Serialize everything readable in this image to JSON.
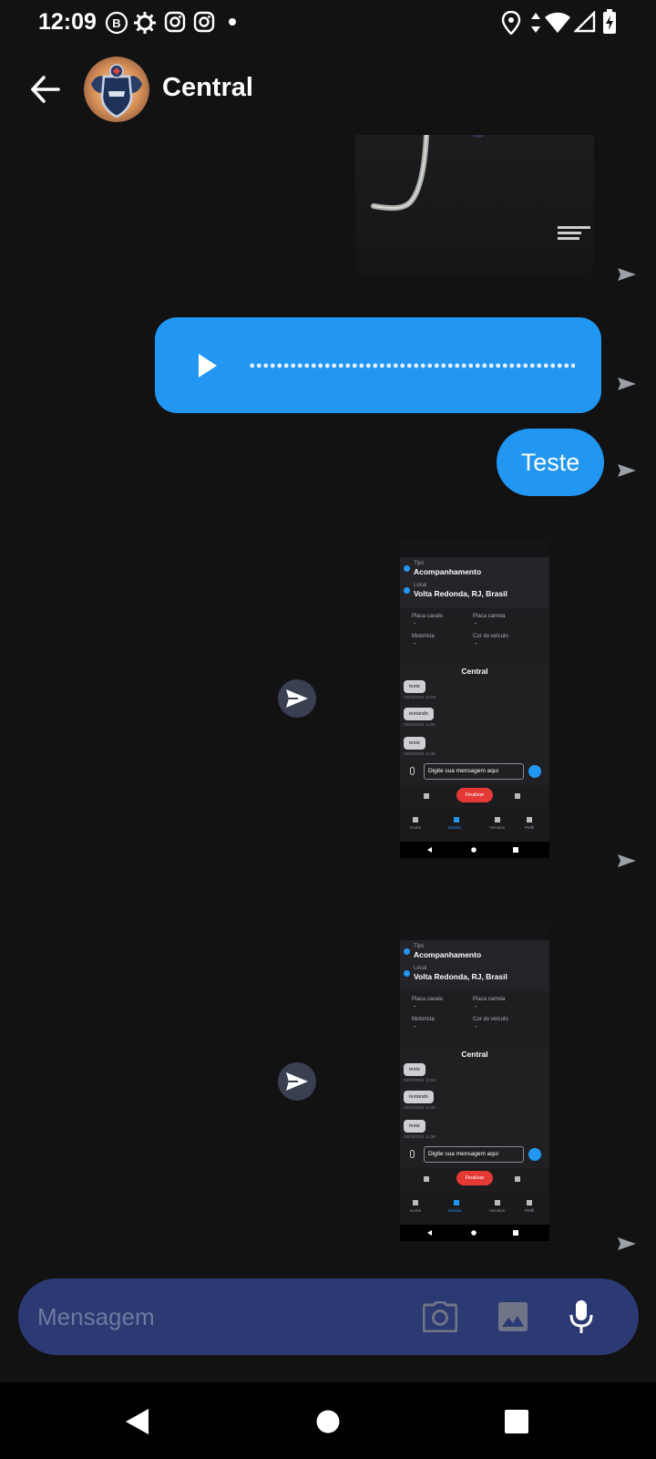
{
  "status_bar": {
    "time": "12:09",
    "left_icons": [
      "b-notification-icon",
      "settings-notification-icon",
      "instagram-icon",
      "instagram-icon",
      "dot-icon"
    ],
    "right_icons": [
      "location-icon",
      "data-arrows-icon",
      "wifi-icon",
      "signal-icon",
      "battery-charging-icon"
    ]
  },
  "header": {
    "contact_name": "Central",
    "back_icon": "arrow-back-icon",
    "avatar_icon": "shield-logo-avatar"
  },
  "messages": [
    {
      "type": "image",
      "direction": "out",
      "status": "sent"
    },
    {
      "type": "audio",
      "direction": "out",
      "status": "sent"
    },
    {
      "type": "text",
      "direction": "out",
      "text": "Teste",
      "status": "sent"
    },
    {
      "type": "image",
      "direction": "out",
      "status": "sent"
    },
    {
      "type": "image",
      "direction": "out",
      "status": "sent"
    }
  ],
  "screenshot": {
    "tipo_label": "Tipo",
    "tipo_value": "Acompanhamento",
    "local_label": "Local",
    "local_value": "Volta Redonda, RJ, Brasil",
    "placa_cavalo": "Placa cavalo",
    "placa_carreta": "Placa carreta",
    "motorista": "Motorista",
    "cor_veiculo": "Cor do veículo",
    "dash": "-",
    "chat_title": "Central",
    "msg1": "teste",
    "msg2": "testando",
    "msg3": "teste",
    "ts1": "03/02/2024 10:59",
    "ts2": "03/02/2024 11:05",
    "ts3": "03/02/2024 11:38",
    "input_placeholder": "Digite sua mensagem aqui",
    "finalizar": "Finalizar",
    "nav_home": "Home",
    "nav_missao": "Missão",
    "nav_veiculos": "Veículos",
    "nav_perfil": "Perfil"
  },
  "composer": {
    "placeholder": "Mensagem",
    "camera_icon": "camera-icon",
    "gallery_icon": "image-icon",
    "mic_icon": "microphone-icon"
  },
  "colors": {
    "background": "#121212",
    "bubble": "#2196f3",
    "composer": "#2b3a73",
    "forward_button": "#3a3f52",
    "finalizar": "#e53935"
  }
}
